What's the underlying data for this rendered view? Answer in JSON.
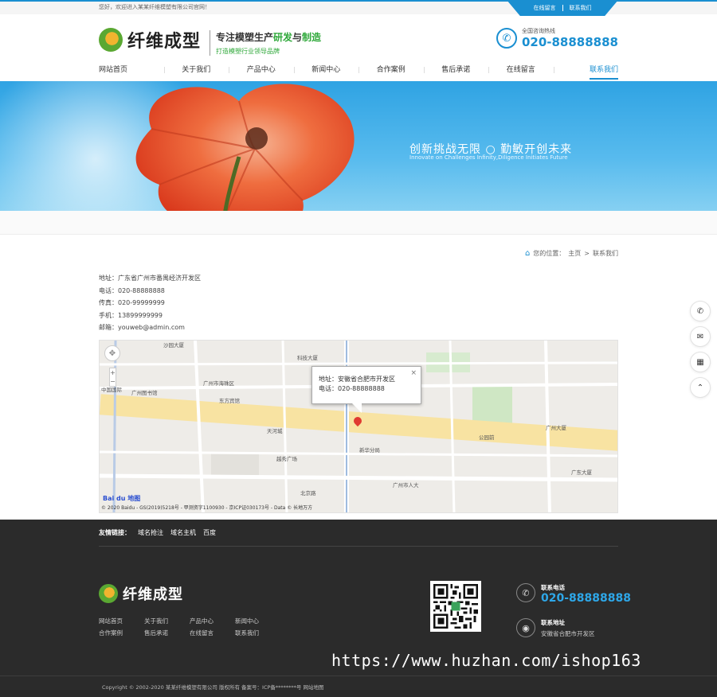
{
  "topbar": {
    "welcome": "您好，欢迎进入某某纤维模塑有限公司官网！",
    "tab_message": "在线留言",
    "tab_contact": "联系我们"
  },
  "header": {
    "logo_text": "纤维成型",
    "slogan_pre": "专注模塑生产",
    "slogan_em1": "研发",
    "slogan_mid": "与",
    "slogan_em2": "制造",
    "slogan_sub": "打造模塑行业领导品牌",
    "hotline_label": "全国咨询热线",
    "hotline_number": "020-88888888"
  },
  "nav": {
    "items": [
      "网站首页",
      "关于我们",
      "产品中心",
      "新闻中心",
      "合作案例",
      "售后承诺",
      "在线留言",
      "联系我们"
    ],
    "active_index": 7
  },
  "banner": {
    "headline_part1": "创新挑战无限",
    "headline_part2": "勤敏开创未来",
    "subline": "Innovate on Challenges Infinity,Diligence Initiates Future"
  },
  "breadcrumb": {
    "label": "您的位置：",
    "home": "主页",
    "separator": ">",
    "current": "联系我们"
  },
  "contact": {
    "address": "地址：广东省广州市番禺经济开发区",
    "phone": "电话：020-88888888",
    "fax": "传真：020-99999999",
    "mobile": "手机：13899999999",
    "email": "邮箱：youweb@admin.com"
  },
  "map": {
    "popup_address": "地址：安徽省合肥市开发区",
    "popup_phone": "电话：020-88888888",
    "logo_text": "Bai du 地图",
    "copyright": "© 2020 Baidu - GS(2019)5218号 - 甲测资字1100930 - 京ICP证030173号 - Data © 长地万方",
    "labels": [
      "沙园大厦",
      "科技大厦",
      "广州图书馆",
      "广州市海珠区",
      "东方宾馆",
      "越秀广场",
      "天河城",
      "新华分局",
      "中国国际",
      "广州大厦",
      "北京路",
      "广州市人大",
      "公园前",
      "广东大厦"
    ]
  },
  "sidebar": {
    "icons": [
      "phone-icon",
      "chat-icon",
      "qrcode-icon",
      "arrow-up-icon"
    ]
  },
  "footer": {
    "links_label": "友情链接：",
    "links": [
      "域名抢注",
      "域名主机",
      "百度"
    ],
    "logo_text": "纤维成型",
    "nav": [
      "网站首页",
      "关于我们",
      "产品中心",
      "新闻中心",
      "合作案例",
      "售后承诺",
      "在线留言",
      "联系我们"
    ],
    "phone_label": "联系电话",
    "phone_number": "020-88888888",
    "address_label": "联系地址",
    "address": "安徽省合肥市开发区",
    "watermark": "https://www.huzhan.com/ishop163",
    "copyright": "Copyright © 2002-2020 某某纤维模塑有限公司 版权所有  备案号：ICP备********号  网站地图"
  },
  "colors": {
    "accent": "#1a8fd1",
    "green": "#2fa83a",
    "footer_bg": "#2b2b2b"
  }
}
